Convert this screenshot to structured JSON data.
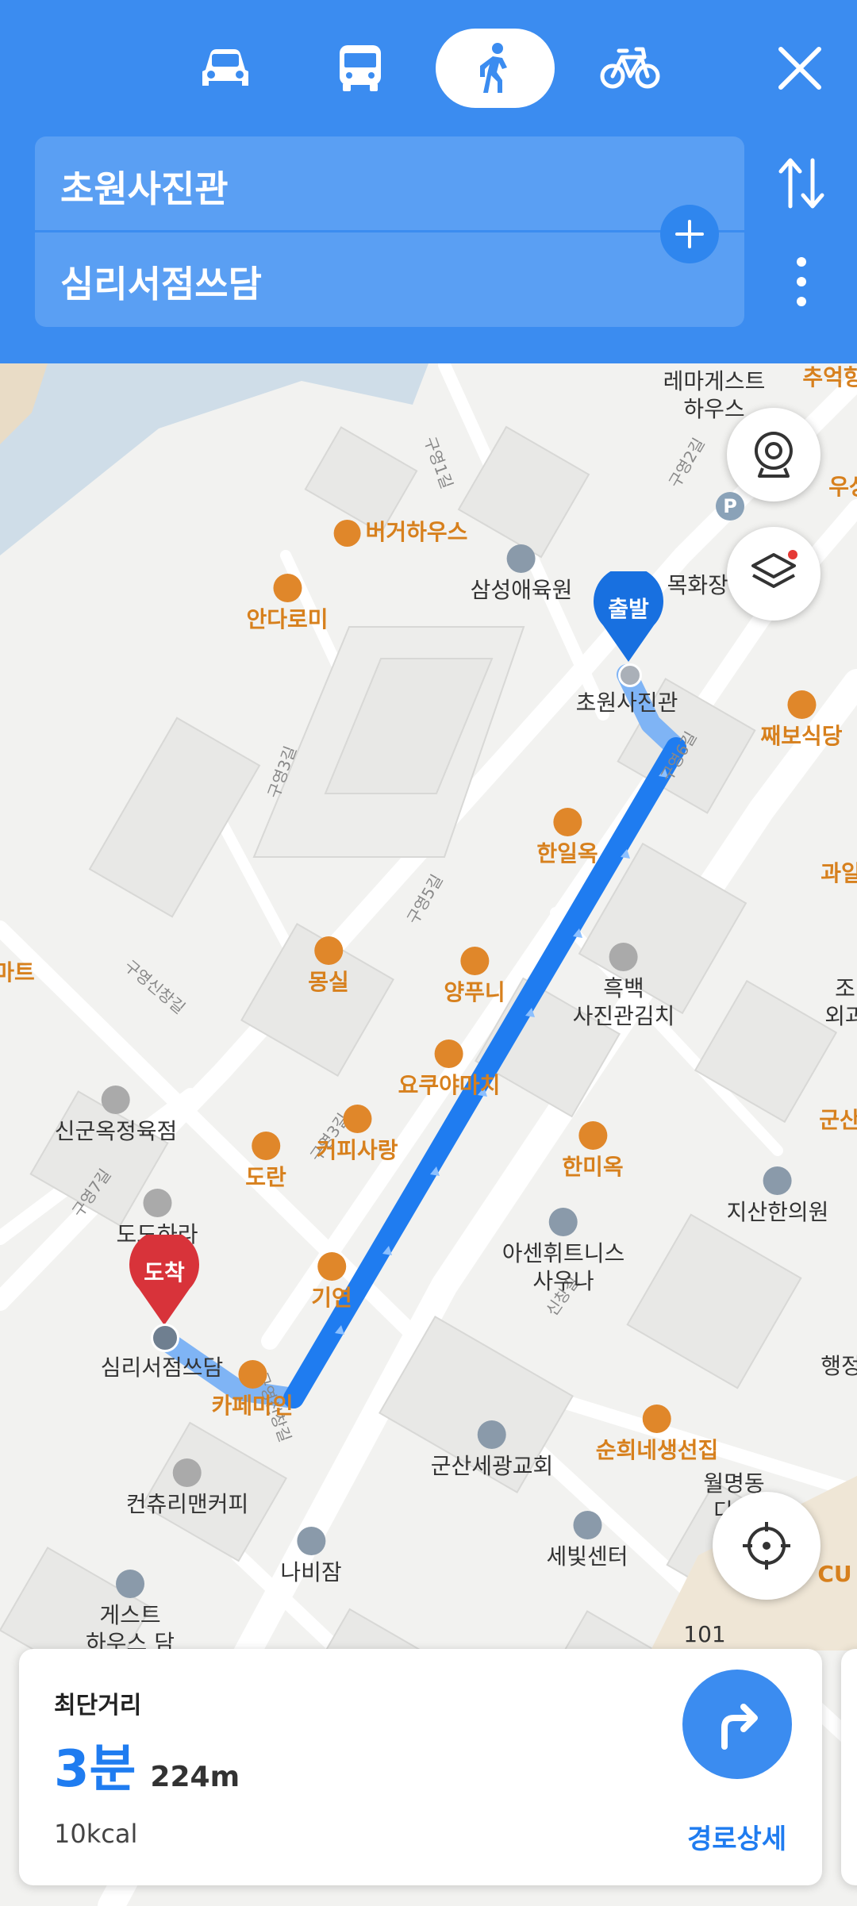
{
  "header": {
    "modes": [
      "car-icon",
      "bus-icon",
      "walk-icon",
      "bike-icon"
    ],
    "active_mode": "walk",
    "origin": "초원사진관",
    "destination": "심리서점쓰담"
  },
  "map": {
    "markers": {
      "start": "출발",
      "end": "도착"
    },
    "pois": {
      "lema": "레마게스트\n하우스",
      "chueok": "추억항",
      "uusang": "우상",
      "burger": "버거하우스",
      "samsung": "삼성애육원",
      "andaromi": "안다로미",
      "mokhwa": "목화장여관",
      "chowon": "초원사진관",
      "jjaebo": "째보식당",
      "hanil": "한일옥",
      "gwa": "과일",
      "mongsil": "몽실",
      "yangpuni": "양푸니",
      "heukbaek": "흑백\n사진관김치",
      "jo": "조\n외과",
      "mart": "마트",
      "yokuya": "요쿠야마치",
      "singun": "신군옥정육점",
      "coffeesarang": "커피사랑",
      "doran": "도란",
      "hanmi": "한미옥",
      "gunsan": "군산",
      "jisan": "지산한의원",
      "dodohara": "도도하라",
      "asen": "아센휘트니스\n사우나",
      "giyeon": "기연",
      "simri": "심리서점쓰담",
      "cafemain": "카페마인",
      "haengjeong": "행정",
      "sunhui": "순희네생선집",
      "church": "군산세광교회",
      "wolmyeong": "월명동\n다운",
      "country": "컨츄리맨커피",
      "sebit": "세빛센터",
      "nabijam": "나비잠",
      "guesthouse": "게스트\n하우스 담",
      "cu": "CU",
      "num101": "101"
    },
    "roads": [
      "구영1길",
      "구영2길",
      "구영3길",
      "구영5길",
      "구영6길",
      "구영신창길",
      "구영7길",
      "구영3길",
      "신창길",
      "구영신창길"
    ]
  },
  "route_card": {
    "label": "최단거리",
    "time": "3분",
    "distance": "224m",
    "calories": "10kcal",
    "detail_button": "경로상세"
  },
  "colors": {
    "header": "#3b8cf0",
    "route": "#1f7cf0",
    "start_pin": "#1870e0",
    "end_pin": "#d8333a",
    "poi_food": "#d7801d"
  }
}
